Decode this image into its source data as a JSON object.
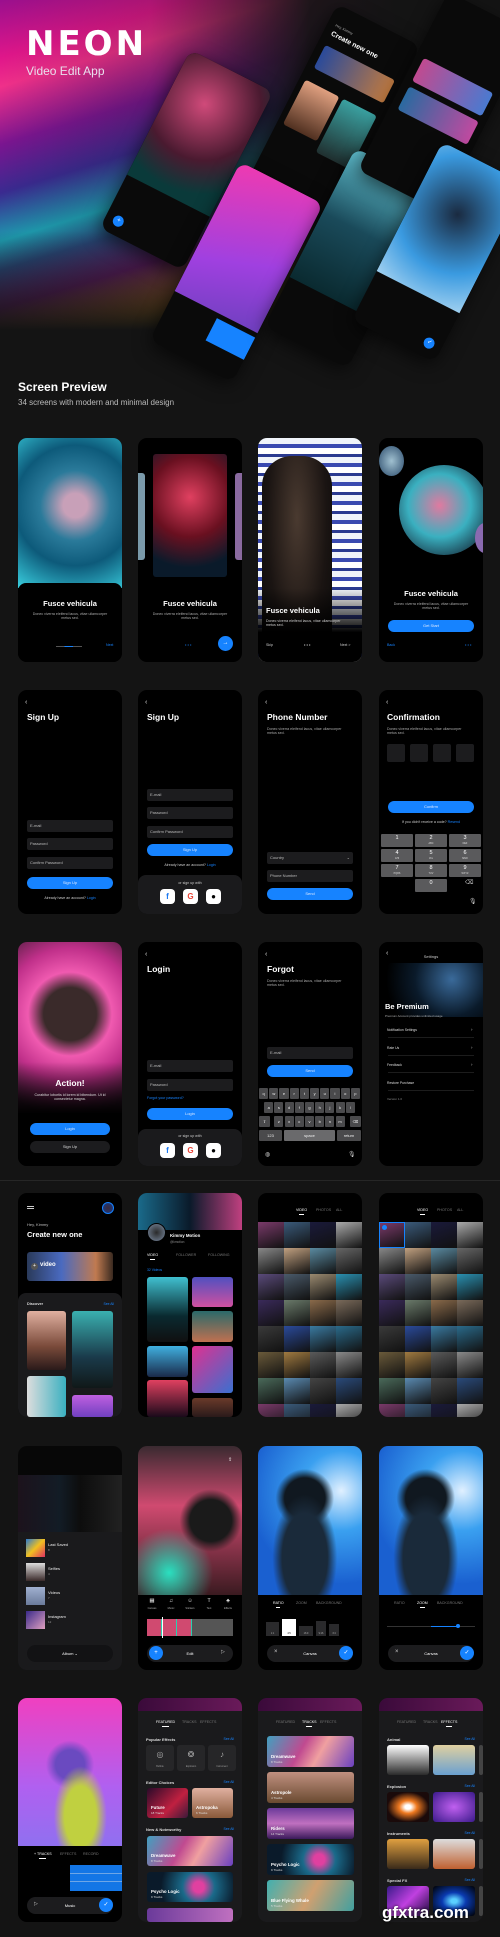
{
  "hero": {
    "brand": "NEON",
    "subtitle": "Video Edit App"
  },
  "hero_mockups": {
    "greeting": "Hey, Kimmy",
    "title": "Create new one"
  },
  "preview": {
    "title": "Screen Preview",
    "subtitle": "34 screens with modern and minimal design"
  },
  "onboarding": {
    "title": "Fusce vehicula",
    "desc": "Donec viverra eleifend lacus, vitae ullamcorper metus sed.",
    "next": "Next",
    "skip": "Skip",
    "next_arrow": "Next >",
    "get_start": "Get Start",
    "back": "Back"
  },
  "signup": {
    "title": "Sign Up",
    "email": "E-mail",
    "password": "Password",
    "confirm": "Confirm Password",
    "button": "Sign Up",
    "already": "Already have an account?",
    "login_link": "Login",
    "or_with": "or sign up with"
  },
  "phone": {
    "title": "Phone Number",
    "desc": "Donec viverra eleifend lacus, vitae ullamcorper metus sed.",
    "country": "Country",
    "number": "Phone Number",
    "send": "Send"
  },
  "confirmation": {
    "title": "Confirmation",
    "desc": "Donec viverra eleifend lacus, vitae ullamcorper metus sed.",
    "button": "Confirm",
    "no_code": "If you didn't receive a code?",
    "resend": "Resend",
    "keys": [
      {
        "n": "1",
        "l": ""
      },
      {
        "n": "2",
        "l": "ABC"
      },
      {
        "n": "3",
        "l": "DEF"
      },
      {
        "n": "4",
        "l": "GHI"
      },
      {
        "n": "5",
        "l": "JKL"
      },
      {
        "n": "6",
        "l": "MNO"
      },
      {
        "n": "7",
        "l": "PQRS"
      },
      {
        "n": "8",
        "l": "TUV"
      },
      {
        "n": "9",
        "l": "WXYZ"
      },
      {
        "n": "0",
        "l": ""
      }
    ]
  },
  "action": {
    "title": "Action!",
    "desc": "Curabitur lobortis id lorem id bibendum. Ut id consectetur magna.",
    "login": "Login",
    "signup": "Sign Up"
  },
  "login": {
    "title": "Login",
    "email": "E-mail",
    "password": "Password",
    "forgot": "Forgot your password?",
    "button": "Login",
    "or_with": "or sign up with"
  },
  "forgot": {
    "title": "Forgot",
    "desc": "Donec viverra eleifend lacus, vitae ullamcorper metus sed.",
    "email": "E-mail",
    "send": "Send",
    "keyboard_rows": [
      "qwertyuiop",
      "asdfghjkl",
      "zxcvbnm"
    ],
    "key_123": "123",
    "key_space": "space",
    "key_return": "return"
  },
  "settings": {
    "title": "Settings",
    "premium": "Be Premium",
    "premium_desc": "Premium Account provides unlimited usage",
    "items": [
      "Notification Settings",
      "Rate Us",
      "Feedback",
      "Restore Purchase"
    ],
    "version": "Version 1.0"
  },
  "home": {
    "greeting": "Hey, Kimmy",
    "title": "Create new one",
    "video": "video",
    "discover": "Discover",
    "see_all": "See All"
  },
  "profile": {
    "name": "Kimmy Motion",
    "handle": "@kmotion",
    "tabs": [
      "VIDEO",
      "FOLLOWER",
      "FOLLOWING"
    ],
    "count": "32 Videos"
  },
  "gallery": {
    "tabs": [
      "VIDEO",
      "PHOTOS",
      "ALL"
    ],
    "album": "Album ^"
  },
  "albums": {
    "items": [
      {
        "name": "Last Saved",
        "count": "8"
      },
      {
        "name": "Selfies",
        "count": "4"
      },
      {
        "name": "Videos",
        "count": "7"
      },
      {
        "name": "Instagram",
        "count": "12"
      }
    ],
    "button": "Album ⌄"
  },
  "editor": {
    "tools": [
      "Canvas",
      "Music",
      "Stickers",
      "Text",
      "Effects"
    ],
    "label": "Edit"
  },
  "canvas": {
    "tabs": [
      "RATIO",
      "ZOOM",
      "BACKGROUND"
    ],
    "ratios": [
      "1:1",
      "4:5",
      "16:9",
      "9:16",
      "3:4"
    ],
    "label": "Canvas"
  },
  "music": {
    "tabs": [
      "+ TRACKS",
      "EFFECTS",
      "RECORD"
    ],
    "label": "Music"
  },
  "featured": {
    "tabs": [
      "FEATURED",
      "TRACKS",
      "EFFECTS"
    ],
    "popular": "Popular Effects",
    "popular_items": [
      "Bubble",
      "Explosion",
      "Instrument"
    ],
    "editor_choices": "Editor Choices",
    "choices": [
      {
        "name": "Future",
        "count": "18 Tracks"
      },
      {
        "name": "Astropoka",
        "count": "6 Tracks"
      }
    ],
    "noteworthy": "New & Noteworthy",
    "noteworthy_items": [
      {
        "name": "Dreamwave",
        "count": "8 Tracks"
      },
      {
        "name": "Psycho Logic",
        "count": "9 Tracks"
      }
    ],
    "see_all": "See All"
  },
  "tracks": {
    "items": [
      {
        "name": "Dreamwave",
        "count": "8 Tracks"
      },
      {
        "name": "Astropole",
        "count": "4 Tracks"
      },
      {
        "name": "Riders",
        "count": "14 Tracks"
      },
      {
        "name": "Psycho Logic",
        "count": "9 Tracks"
      },
      {
        "name": "Blue Flying Whale",
        "count": "5 Tracks"
      }
    ]
  },
  "effects": {
    "sections": [
      "Animal",
      "Explosion",
      "Instruments",
      "Special FX"
    ],
    "see_all": "See All"
  },
  "watermark": "gfxtra.com",
  "colors": {
    "accent": "#1683ff",
    "background": "#141414",
    "phone": "#000000",
    "field": "#1c1c1e"
  }
}
